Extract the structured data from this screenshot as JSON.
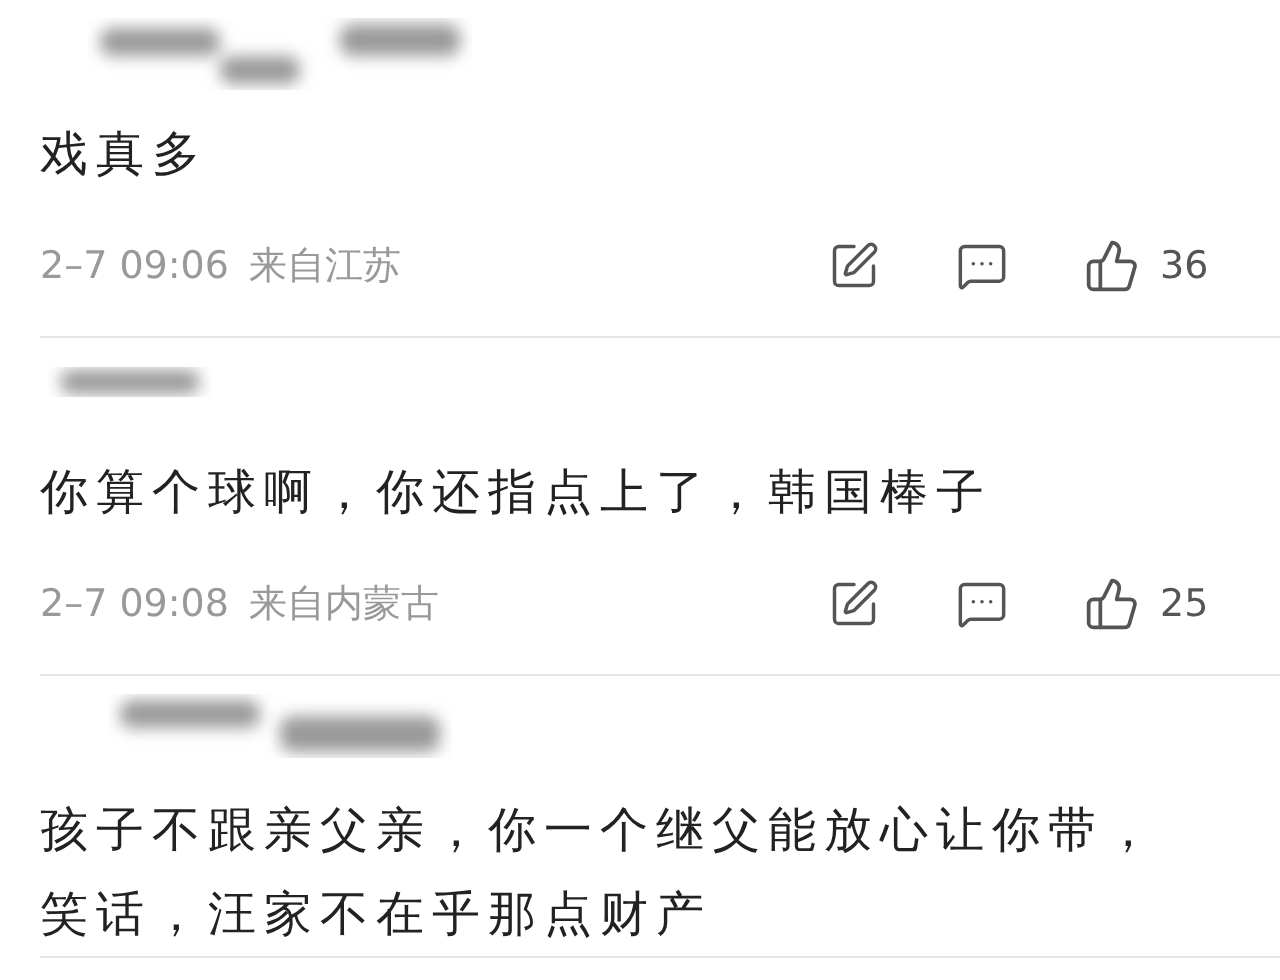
{
  "comments": [
    {
      "text": "戏真多",
      "date": "2–7 09:06",
      "location": "来自江苏",
      "likes": "36"
    },
    {
      "text": "你算个球啊，你还指点上了，韩国棒子",
      "date": "2–7 09:08",
      "location": "来自内蒙古",
      "likes": "25"
    },
    {
      "text": "孩子不跟亲父亲，你一个继父能放心让你带，笑话，汪家不在乎那点财产"
    }
  ]
}
